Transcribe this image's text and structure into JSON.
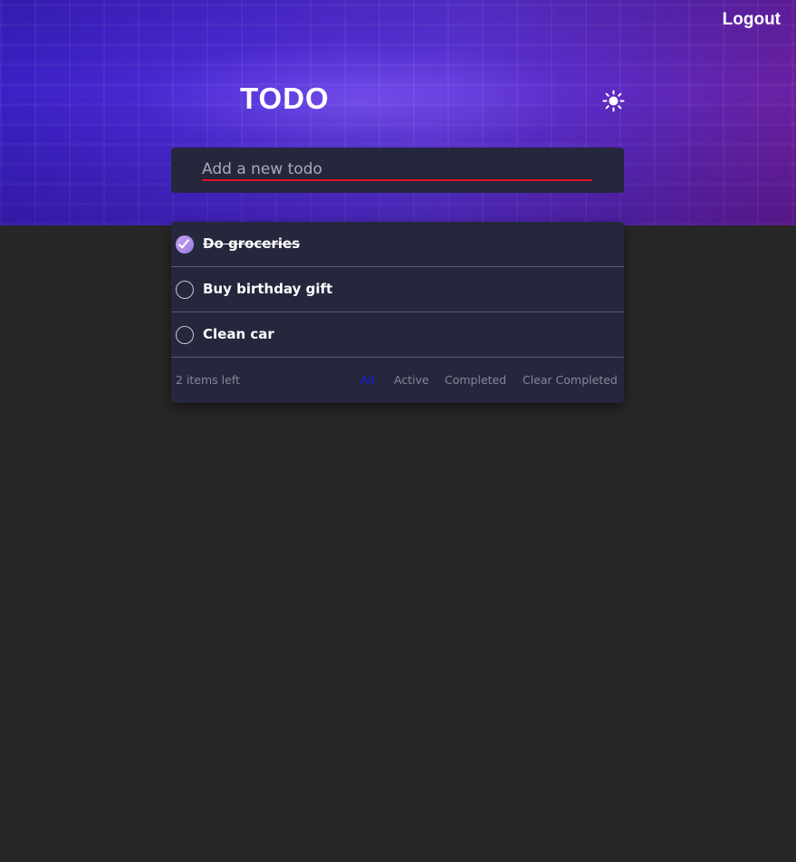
{
  "header": {
    "logout_label": "Logout",
    "title": "TODO",
    "theme_icon": "sun-icon"
  },
  "new_todo": {
    "placeholder": "Add a new todo",
    "value": ""
  },
  "todos": [
    {
      "text": "Do groceries",
      "completed": true
    },
    {
      "text": "Buy birthday gift",
      "completed": false
    },
    {
      "text": "Clean car",
      "completed": false
    }
  ],
  "footer": {
    "items_left": "2 items left",
    "filters": [
      "All",
      "Active",
      "Completed"
    ],
    "active_filter": "All",
    "clear_label": "Clear Completed"
  },
  "colors": {
    "card_bg": "#25273c",
    "page_bg": "#282727",
    "active_filter": "#1a1ae8",
    "input_underline": "#e0102a",
    "check_gradient": [
      "#c3a2f0",
      "#9b7de0"
    ]
  }
}
